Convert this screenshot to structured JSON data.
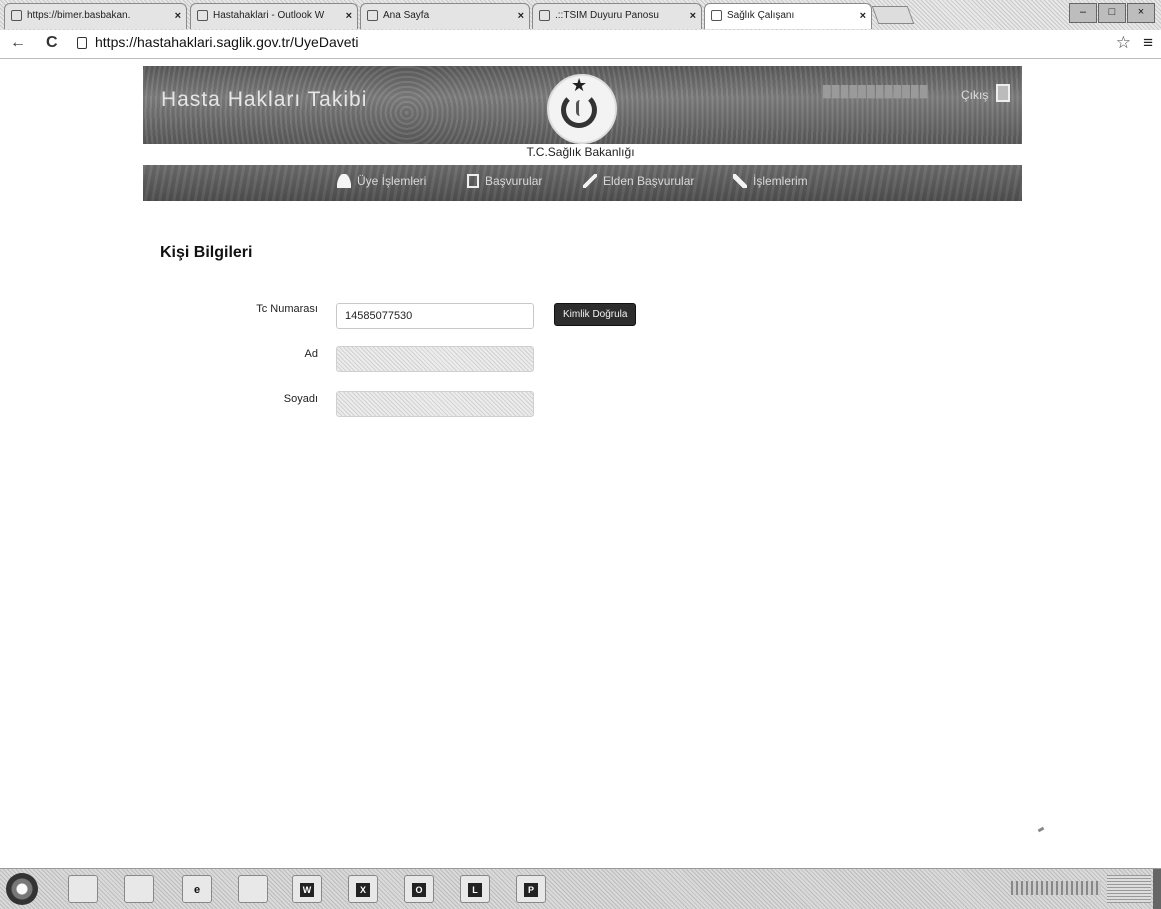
{
  "browser": {
    "tabs": [
      {
        "label": "https://bimer.basbakan.",
        "active": false
      },
      {
        "label": "Hastahaklari - Outlook W",
        "active": false
      },
      {
        "label": "Ana Sayfa",
        "active": false
      },
      {
        "label": ".::TSIM Duyuru Panosu",
        "active": false
      },
      {
        "label": "Sağlık Çalışanı",
        "active": true
      }
    ],
    "url": "https://hastahaklari.saglik.gov.tr/UyeDaveti"
  },
  "header": {
    "brand": "Hasta Hakları Takibi",
    "ministry": "T.C.Sağlık Bakanlığı",
    "logout_label": "Çıkış"
  },
  "nav": {
    "items": [
      {
        "label": "Üye İşlemleri",
        "icon": "user-icon"
      },
      {
        "label": "Başvurular",
        "icon": "document-icon"
      },
      {
        "label": "Elden Başvurular",
        "icon": "pencil-icon"
      },
      {
        "label": "İşlemlerim",
        "icon": "wrench-icon"
      }
    ]
  },
  "form": {
    "title": "Kişi Bilgileri",
    "tc_label": "Tc Numarası",
    "tc_value": "14585077530",
    "verify_label": "Kimlik Doğrula",
    "ad_label": "Ad",
    "soyad_label": "Soyadı"
  },
  "taskbar": {
    "apps": [
      {
        "name": "explorer-icon",
        "label": ""
      },
      {
        "name": "ministry-app-icon",
        "label": ""
      },
      {
        "name": "internet-explorer-icon",
        "label": "e"
      },
      {
        "name": "chrome-icon",
        "label": ""
      },
      {
        "name": "word-icon",
        "label": "W"
      },
      {
        "name": "excel-icon",
        "label": "X"
      },
      {
        "name": "outlook-icon",
        "label": "O"
      },
      {
        "name": "lync-icon",
        "label": "L"
      },
      {
        "name": "powerpoint-icon",
        "label": "P"
      }
    ]
  }
}
